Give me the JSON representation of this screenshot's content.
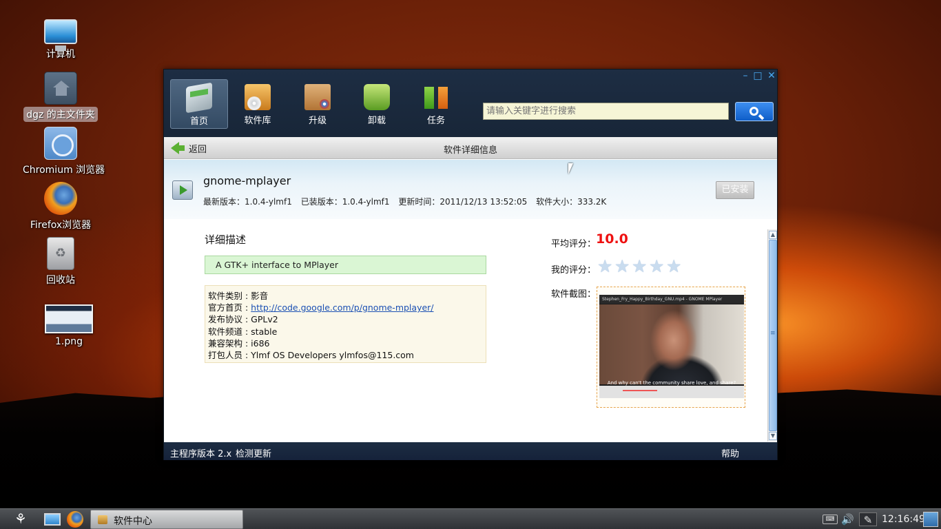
{
  "desktop": {
    "icons": [
      {
        "label": "计算机",
        "icon": "computer-icon"
      },
      {
        "label": "dgz 的主文件夹",
        "icon": "home-folder-icon"
      },
      {
        "label": "Chromium 浏览器",
        "icon": "chromium-icon"
      },
      {
        "label": "Firefox浏览器",
        "icon": "firefox-icon"
      },
      {
        "label": "回收站",
        "icon": "trash-icon"
      },
      {
        "label": "1.png",
        "icon": "image-thumbnail-icon"
      }
    ]
  },
  "window": {
    "controls": {
      "minimize": "–",
      "maximize": "□",
      "close": "✕"
    },
    "nav": [
      {
        "label": "首页",
        "icon": "home-icon",
        "active": true
      },
      {
        "label": "软件库",
        "icon": "software-library-icon",
        "active": false
      },
      {
        "label": "升级",
        "icon": "upgrade-icon",
        "active": false
      },
      {
        "label": "卸载",
        "icon": "uninstall-icon",
        "active": false
      },
      {
        "label": "任务",
        "icon": "tasks-icon",
        "active": false
      }
    ],
    "search": {
      "placeholder": "请输入关键字进行搜索",
      "value": ""
    },
    "breadcrumb": {
      "back_label": "返回",
      "title": "软件详细信息"
    },
    "package": {
      "name": "gnome-mplayer",
      "latest_version": "最新版本：1.0.4-ylmf1",
      "installed_version": "已装版本：1.0.4-ylmf1",
      "updated": "更新时间：2011/12/13 13:52:05",
      "size": "软件大小：333.2K",
      "installed_button": "已安装"
    },
    "details": {
      "heading": "详细描述",
      "description": "A GTK+ interface to MPlayer",
      "properties": [
        {
          "key": "软件类别 : ",
          "value": "影音",
          "link": false
        },
        {
          "key": "官方首页 : ",
          "value": "http://code.google.com/p/gnome-mplayer/",
          "link": true
        },
        {
          "key": "发布协议 : ",
          "value": "GPLv2",
          "link": false
        },
        {
          "key": "软件频道 : ",
          "value": "stable",
          "link": false
        },
        {
          "key": "兼容架构 : ",
          "value": "i686",
          "link": false
        },
        {
          "key": "打包人员 : ",
          "value": "Ylmf OS Developers ylmfos@115.com",
          "link": false
        }
      ]
    },
    "rating": {
      "avg_label": "平均评分：",
      "avg_value": "10.0",
      "my_label": "我的评分：",
      "my_stars": 0,
      "max_stars": 5,
      "screenshot_label": "软件截图：",
      "screenshot_title": "Stephen_Fry_Happy_Birthday_GNU.mp4 - GNOME MPlayer",
      "screenshot_subtitle": "And why can't the community share love, and share?"
    },
    "statusbar": {
      "version": "主程序版本 2.x",
      "check_update": "检测更新",
      "help": "帮助"
    }
  },
  "taskbar": {
    "task_label": "软件中心",
    "keyboard": "⌨",
    "volume": "🔊",
    "clock": "12:16:49"
  },
  "colors": {
    "accent": "#e11111",
    "nav_bg": "#1d2d43",
    "link": "#1a4fb3"
  }
}
